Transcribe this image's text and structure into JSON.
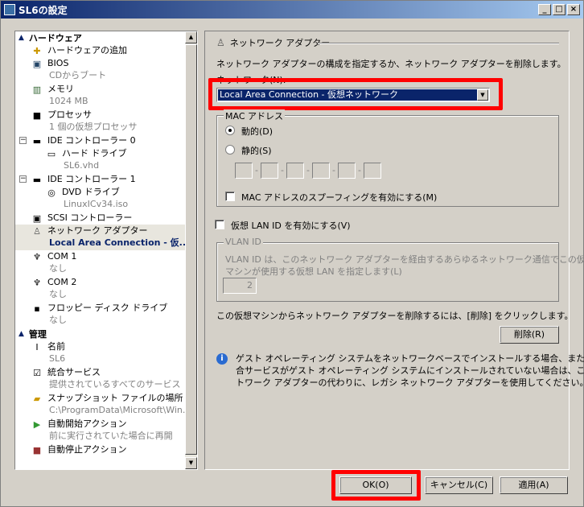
{
  "window": {
    "title": "SL6の設定"
  },
  "tree": {
    "section_hardware": "ハードウェア",
    "section_management": "管理",
    "items": [
      {
        "label": "ハードウェアの追加",
        "sub": ""
      },
      {
        "label": "BIOS",
        "sub": "CDからブート"
      },
      {
        "label": "メモリ",
        "sub": "1024 MB"
      },
      {
        "label": "プロセッサ",
        "sub": "1 個の仮想プロセッサ"
      },
      {
        "label": "IDE コントローラー 0",
        "sub": ""
      },
      {
        "label": "ハード ドライブ",
        "sub": "SL6.vhd"
      },
      {
        "label": "IDE コントローラー 1",
        "sub": ""
      },
      {
        "label": "DVD ドライブ",
        "sub": "LinuxICv34.iso"
      },
      {
        "label": "SCSI コントローラー",
        "sub": ""
      },
      {
        "label": "ネットワーク アダプター",
        "sub": "Local Area Connection - 仮..."
      },
      {
        "label": "COM 1",
        "sub": "なし"
      },
      {
        "label": "COM 2",
        "sub": "なし"
      },
      {
        "label": "フロッピー ディスク ドライブ",
        "sub": "なし"
      },
      {
        "label": "名前",
        "sub": "SL6"
      },
      {
        "label": "統合サービス",
        "sub": "提供されているすべてのサービス"
      },
      {
        "label": "スナップショット ファイルの場所",
        "sub": "C:\\ProgramData\\Microsoft\\Win..."
      },
      {
        "label": "自動開始アクション",
        "sub": "前に実行されていた場合に再開"
      },
      {
        "label": "自動停止アクション",
        "sub": ""
      }
    ]
  },
  "panel": {
    "title": "ネットワーク アダプター",
    "description": "ネットワーク アダプターの構成を指定するか、ネットワーク アダプターを削除します。",
    "network_label": "ネットワーク(N):",
    "network_value": "Local Area Connection - 仮想ネットワーク",
    "mac_group": "MAC アドレス",
    "mac_dynamic": "動的(D)",
    "mac_static": "静的(S)",
    "mac_spoofing": "MAC アドレスのスプーフィングを有効にする(M)",
    "vlan_enable": "仮想 LAN ID を有効にする(V)",
    "vlan_group": "VLAN ID",
    "vlan_desc_1": "VLAN ID は、このネットワーク アダプターを経由するあらゆるネットワーク通信でこの仮想",
    "vlan_desc_2": "マシンが使用する仮想 LAN を指定します(L)",
    "vlan_value": "2",
    "remove_desc": "この仮想マシンからネットワーク アダプターを削除するには、[削除] をクリックします。",
    "remove_button": "削除(R)",
    "info_1": "ゲスト オペレーティング システムをネットワークベースでインストールする場合、または統",
    "info_2": "合サービスがゲスト オペレーティング システムにインストールされていない場合は、このネッ",
    "info_3": "トワーク アダプターの代わりに、レガシ ネットワーク アダプターを使用してください。"
  },
  "footer": {
    "ok": "OK(O)",
    "cancel": "キャンセル(C)",
    "apply": "適用(A)"
  },
  "colors": {
    "highlight": "#ff0000",
    "selection": "#0a246a"
  }
}
